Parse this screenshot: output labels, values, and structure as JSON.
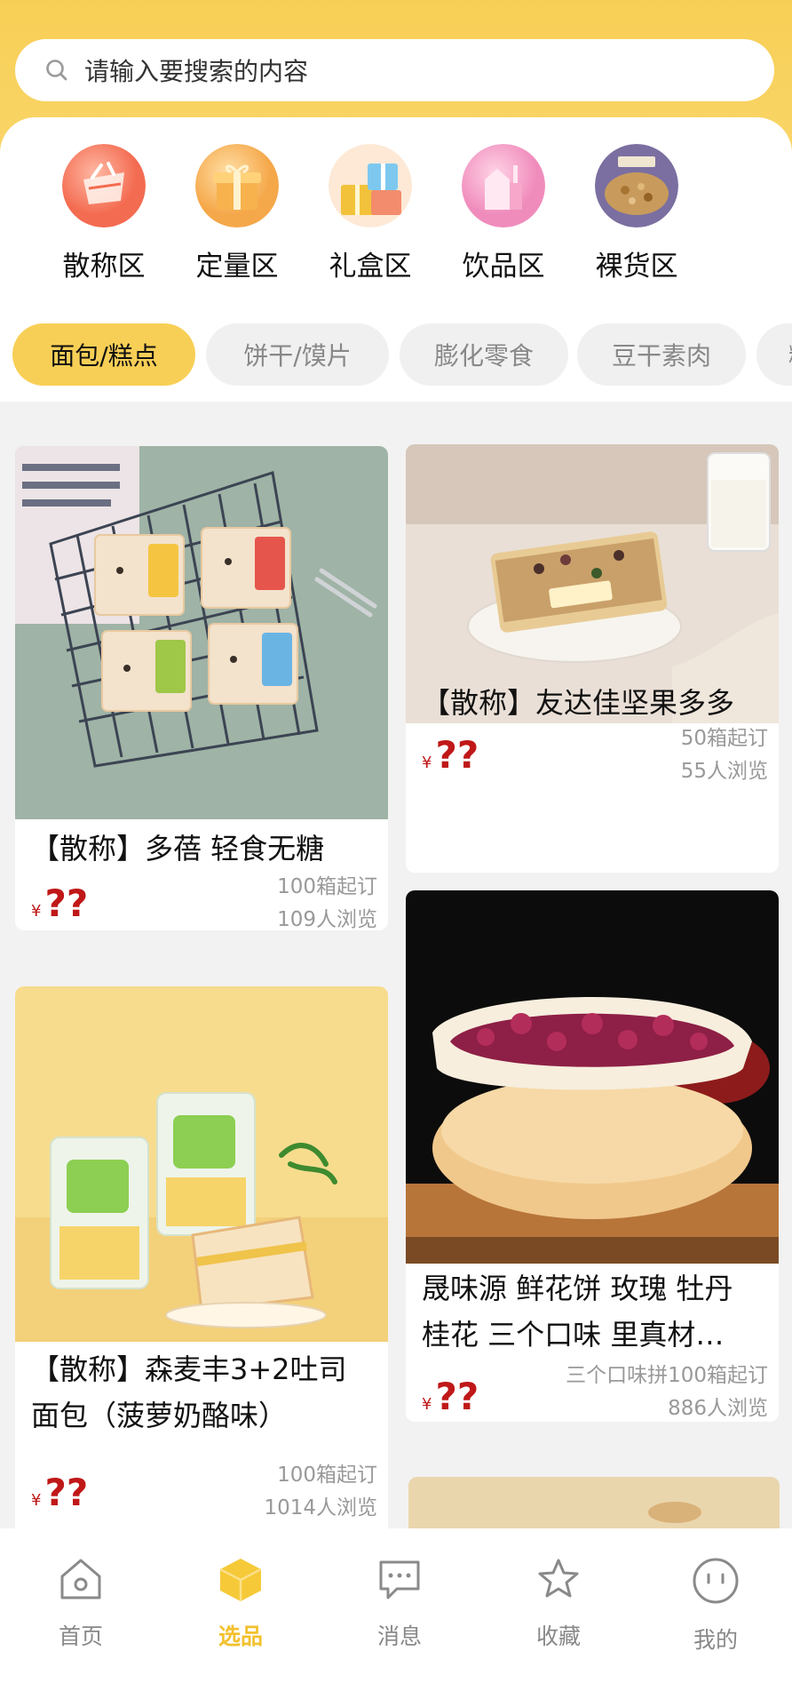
{
  "search": {
    "placeholder": "请输入要搜索的内容",
    "icon": "search-icon"
  },
  "categories": [
    {
      "label": "散称区",
      "icon": "basket-icon",
      "color": "#f57a62"
    },
    {
      "label": "定量区",
      "icon": "gift-box-icon",
      "color": "#f6b45a"
    },
    {
      "label": "礼盒区",
      "icon": "gift-boxes-icon",
      "color": "#62b8e8"
    },
    {
      "label": "饮品区",
      "icon": "drink-carton-icon",
      "color": "#f08cbc"
    },
    {
      "label": "裸货区",
      "icon": "snack-photo-icon",
      "color": "#c8a27a"
    }
  ],
  "tabs": [
    {
      "label": "面包/糕点",
      "active": true
    },
    {
      "label": "饼干/馍片",
      "active": false
    },
    {
      "label": "膨化零食",
      "active": false
    },
    {
      "label": "豆干素肉",
      "active": false
    },
    {
      "label": "糖",
      "active": false
    }
  ],
  "products": [
    {
      "title": "【散称】多蓓 轻食无糖",
      "currency": "¥",
      "price": "??",
      "moq": "100箱起订",
      "views": "109人浏览",
      "image": "bread-packs-on-rack"
    },
    {
      "title": "【散称】友达佳坚果多多",
      "currency": "¥",
      "price": "??",
      "moq": "50箱起订",
      "views": "55人浏览",
      "image": "nut-bar-on-plate"
    },
    {
      "title_line1": "【散称】森麦丰3+2吐司",
      "title_line2": "面包（菠萝奶酪味）",
      "currency": "¥",
      "price": "??",
      "moq": "100箱起订",
      "views": "1014人浏览",
      "image": "toast-sandwich"
    },
    {
      "title_line1": "晟味源 鲜花饼 玫瑰 牡丹",
      "title_line2": "桂花 三个口味 里真材…",
      "currency": "¥",
      "price": "??",
      "moq": "三个口味拼100箱起订",
      "views": "886人浏览",
      "image": "rose-flower-cake"
    }
  ],
  "tabbar": [
    {
      "label": "首页",
      "icon": "home-icon",
      "active": false
    },
    {
      "label": "选品",
      "icon": "box-icon",
      "active": true
    },
    {
      "label": "消息",
      "icon": "message-icon",
      "active": false
    },
    {
      "label": "收藏",
      "icon": "star-icon",
      "active": false
    },
    {
      "label": "我的",
      "icon": "profile-face-icon",
      "active": false
    }
  ],
  "colors": {
    "accent": "#f8cf56",
    "price": "#c01818",
    "tab_active_text": "#f2c12e"
  }
}
